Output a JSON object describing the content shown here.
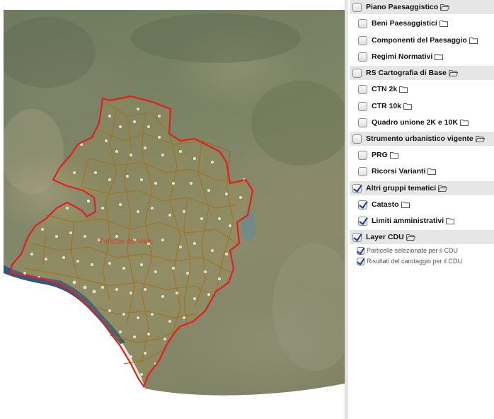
{
  "map": {
    "municipality_label": "Palazzo del Valle"
  },
  "layers": {
    "groups": [
      {
        "label": "Piano Paesaggistico",
        "checked": false,
        "open": true,
        "items": [
          {
            "label": "Beni Paesaggistici",
            "checked": false
          },
          {
            "label": "Componenti del Paesaggio",
            "checked": false
          },
          {
            "label": "Regimi Normativi",
            "checked": false
          }
        ]
      },
      {
        "label": "RS Cartografia di Base",
        "checked": false,
        "open": true,
        "items": [
          {
            "label": "CTN 2k",
            "checked": false
          },
          {
            "label": "CTR 10k",
            "checked": false
          },
          {
            "label": "Quadro unione 2K e 10K",
            "checked": false
          }
        ]
      },
      {
        "label": "Strumento urbanistico vigente",
        "checked": false,
        "open": true,
        "items": [
          {
            "label": "PRG",
            "checked": false
          },
          {
            "label": "Ricorsi Varianti",
            "checked": false
          }
        ]
      },
      {
        "label": "Altri gruppi tematici",
        "checked": true,
        "open": true,
        "items": [
          {
            "label": "Catasto",
            "checked": true
          },
          {
            "label": "Limiti amministrativi",
            "checked": true
          }
        ]
      },
      {
        "label": "Layer CDU",
        "checked": true,
        "open": true,
        "subitems": [
          {
            "label": "Particelle selezionate per il CDU",
            "checked": true
          },
          {
            "label": "Risultati del carotaggio per il CDU",
            "checked": true
          }
        ]
      }
    ]
  }
}
